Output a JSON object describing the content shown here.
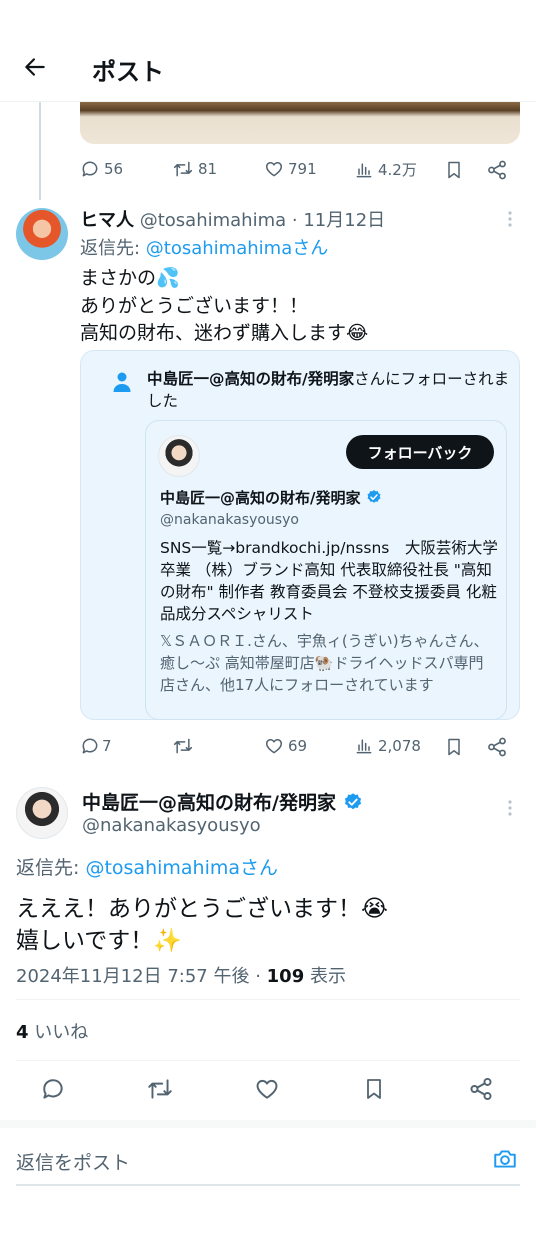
{
  "header": {
    "title": "ポスト"
  },
  "prev_post": {
    "actions": {
      "replies": "56",
      "reposts": "81",
      "likes": "791",
      "views": "4.2万"
    }
  },
  "reply": {
    "display_name": "ヒマ人",
    "handle": "@tosahimahima",
    "separator": " · ",
    "date": "11月12日",
    "replying_to_label": "返信先: ",
    "replying_to_user": "@tosahimahimaさん",
    "lines": [
      "まさかの💦",
      "ありがとうございます！！",
      "高知の財布、迷わず購入します😂"
    ],
    "follow_note_name": "中島匠一@高知の財布/発明家",
    "follow_note_suffix": "さんにフォローされました",
    "quoted_profile": {
      "name": "中島匠一@高知の財布/発明家",
      "handle": "@nakanakasyousyo",
      "follow_back_label": "フォローバック",
      "bio": "SNS一覧→brandkochi.jp/nssns　大阪芸術大学卒業 （株）ブランド高知 代表取締役社長 \"高知の財布\" 制作者 教育委員会 不登校支援委員 化粧品成分スペシャリスト",
      "followed_by": "𝕏ＳＡＯＲＩ.さん、宇魚ィ(うぎい)ちゃんさん、癒し〜ぷ 高知帯屋町店🐏ドライヘッドスパ専門店さん、他17人にフォローされています"
    },
    "actions": {
      "replies": "7",
      "reposts": "",
      "likes": "69",
      "views": "2,078"
    }
  },
  "main_post": {
    "display_name": "中島匠一@高知の財布/発明家",
    "handle": "@nakanakasyousyo",
    "replying_to_label": "返信先: ",
    "replying_to_user": "@tosahimahimaさん",
    "lines": [
      "えええ！ありがとうございます！😭",
      "嬉しいです！✨"
    ],
    "timestamp": "2024年11月12日 7:57 午後",
    "separator": " · ",
    "views_count": "109",
    "views_label": " 表示",
    "likes_count": "4",
    "likes_label": " いいね"
  },
  "composer": {
    "placeholder": "返信をポスト"
  },
  "colors": {
    "accent": "#1d9bf0",
    "text": "#0f1419",
    "secondary": "#536471",
    "card_bg": "#eaf5fd"
  },
  "icons": [
    "back-arrow-icon",
    "reply-icon",
    "repost-icon",
    "like-icon",
    "views-icon",
    "bookmark-icon",
    "share-icon",
    "more-icon",
    "verified-badge-icon",
    "person-icon",
    "camera-icon"
  ]
}
